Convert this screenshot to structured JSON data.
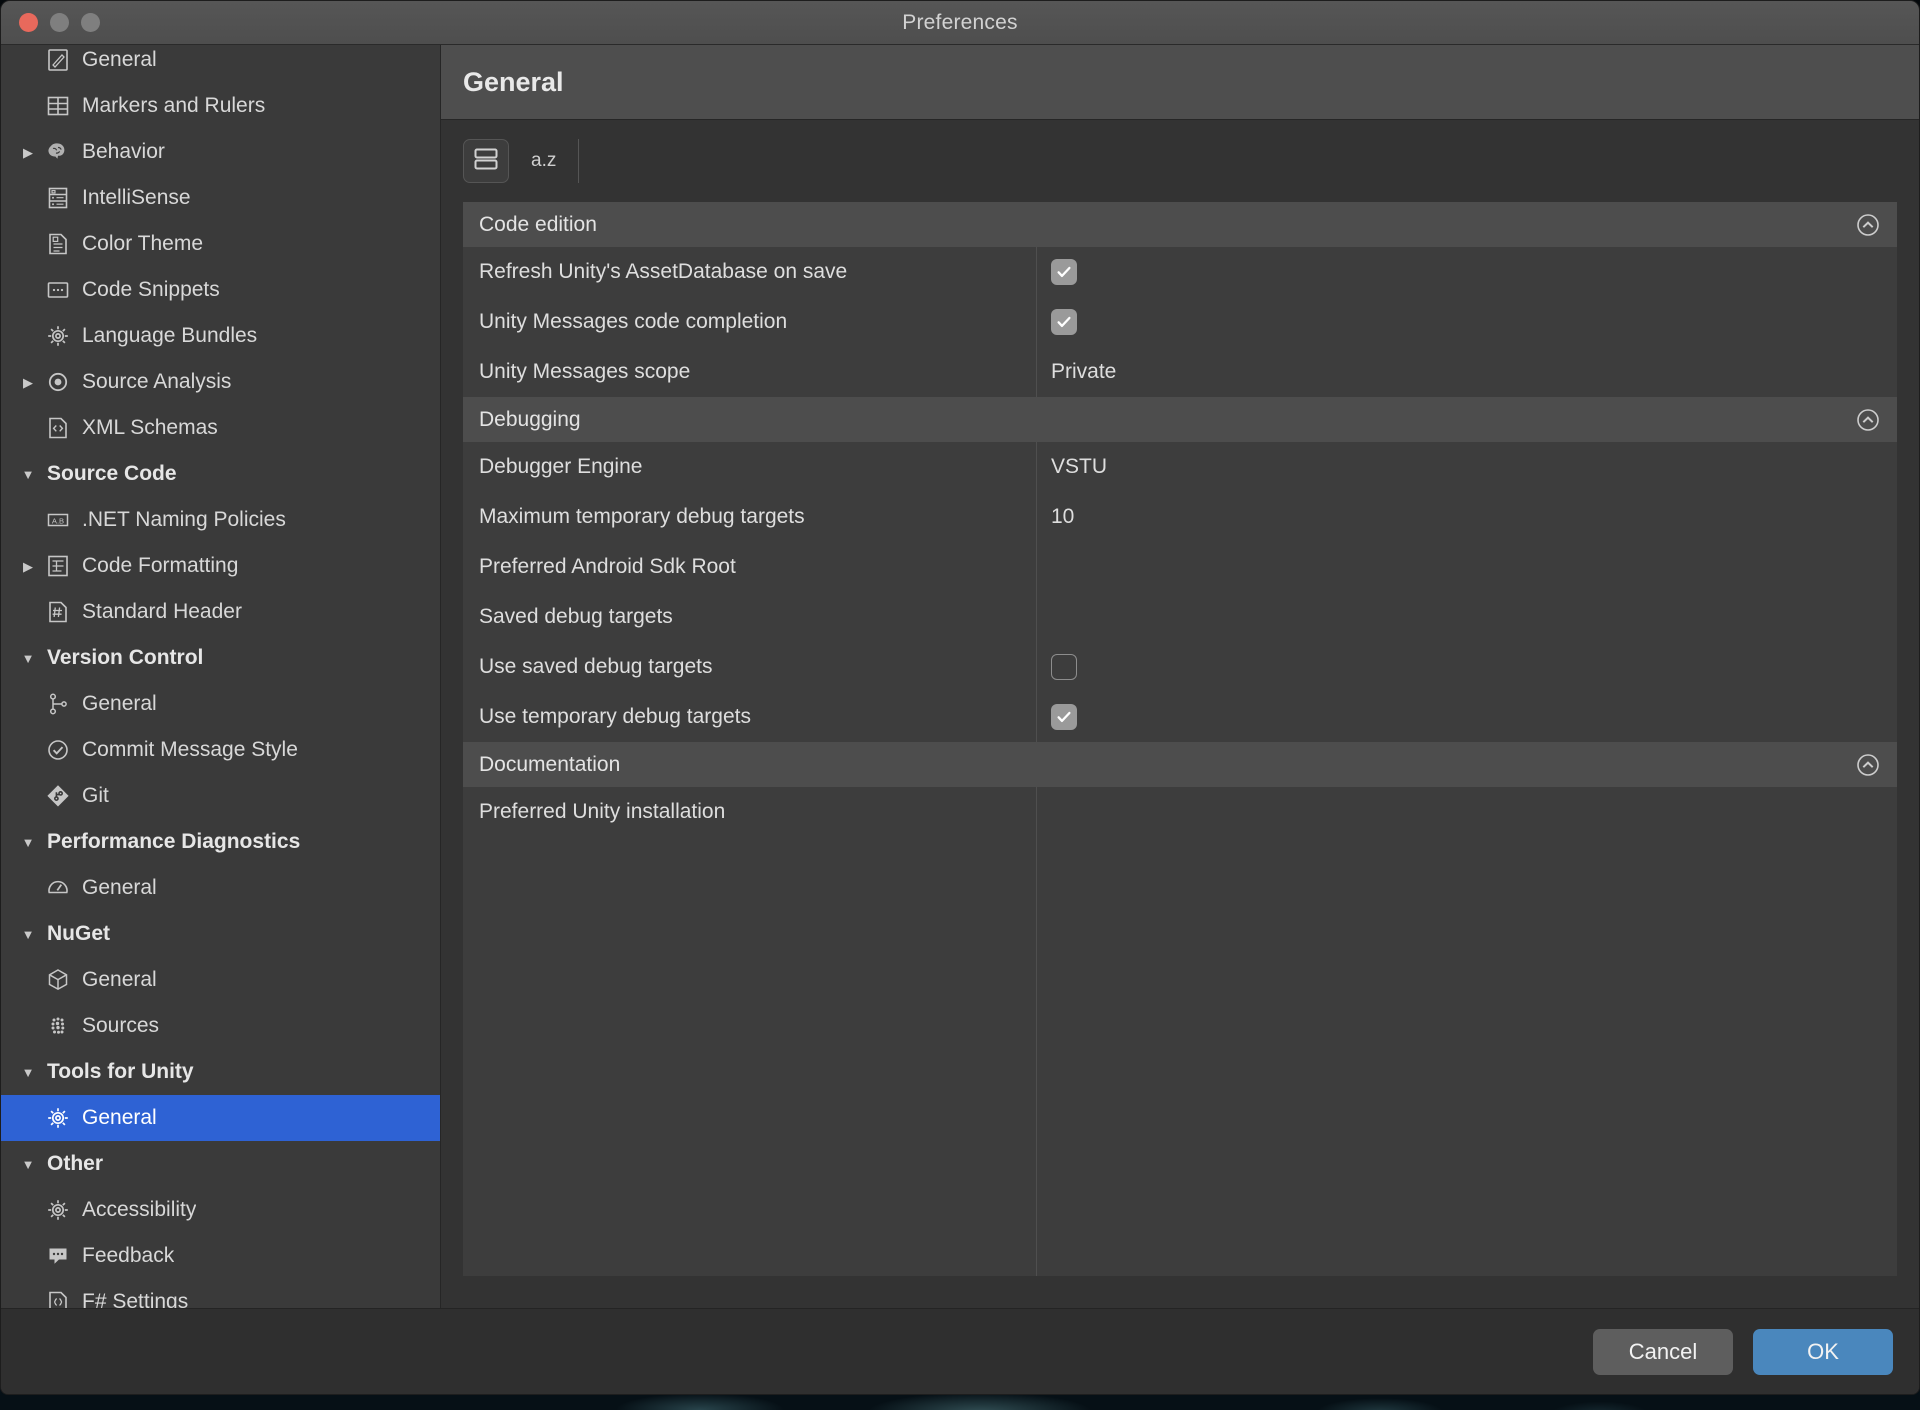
{
  "window": {
    "title": "Preferences",
    "traffic_lights": [
      "close",
      "minimize",
      "zoom"
    ]
  },
  "sidebar": {
    "items": [
      {
        "label": "General",
        "icon": "pencil-document-icon",
        "type": "item",
        "twisty": "none",
        "selected": false,
        "clipped": true
      },
      {
        "label": "Markers and Rulers",
        "icon": "table-grid-icon",
        "type": "item",
        "twisty": "none",
        "selected": false
      },
      {
        "label": "Behavior",
        "icon": "brain-icon",
        "type": "item",
        "twisty": "collapsed",
        "selected": false
      },
      {
        "label": "IntelliSense",
        "icon": "list-server-icon",
        "type": "item",
        "twisty": "none",
        "selected": false
      },
      {
        "label": "Color Theme",
        "icon": "color-document-icon",
        "type": "item",
        "twisty": "none",
        "selected": false
      },
      {
        "label": "Code Snippets",
        "icon": "snippet-icon",
        "type": "item",
        "twisty": "none",
        "selected": false
      },
      {
        "label": "Language Bundles",
        "icon": "gear-icon",
        "type": "item",
        "twisty": "none",
        "selected": false
      },
      {
        "label": "Source Analysis",
        "icon": "radio-target-icon",
        "type": "item",
        "twisty": "collapsed",
        "selected": false
      },
      {
        "label": "XML Schemas",
        "icon": "code-document-icon",
        "type": "item",
        "twisty": "none",
        "selected": false
      },
      {
        "label": "Source Code",
        "icon": "",
        "type": "group",
        "twisty": "expanded",
        "selected": false
      },
      {
        "label": ".NET Naming Policies",
        "icon": "ab-label-icon",
        "type": "item",
        "twisty": "none",
        "selected": false
      },
      {
        "label": "Code Formatting",
        "icon": "tree-format-icon",
        "type": "item",
        "twisty": "collapsed",
        "selected": false
      },
      {
        "label": "Standard Header",
        "icon": "hash-document-icon",
        "type": "item",
        "twisty": "none",
        "selected": false
      },
      {
        "label": "Version Control",
        "icon": "",
        "type": "group",
        "twisty": "expanded",
        "selected": false
      },
      {
        "label": "General",
        "icon": "branch-icon",
        "type": "item",
        "twisty": "none",
        "selected": false
      },
      {
        "label": "Commit Message Style",
        "icon": "check-circle-icon",
        "type": "item",
        "twisty": "none",
        "selected": false
      },
      {
        "label": "Git",
        "icon": "git-icon",
        "type": "item",
        "twisty": "none",
        "selected": false
      },
      {
        "label": "Performance Diagnostics",
        "icon": "",
        "type": "group",
        "twisty": "expanded",
        "selected": false
      },
      {
        "label": "General",
        "icon": "gauge-icon",
        "type": "item",
        "twisty": "none",
        "selected": false
      },
      {
        "label": "NuGet",
        "icon": "",
        "type": "group",
        "twisty": "expanded",
        "selected": false
      },
      {
        "label": "General",
        "icon": "cube-icon",
        "type": "item",
        "twisty": "none",
        "selected": false
      },
      {
        "label": "Sources",
        "icon": "nuget-sources-icon",
        "type": "item",
        "twisty": "none",
        "selected": false
      },
      {
        "label": "Tools for Unity",
        "icon": "",
        "type": "group",
        "twisty": "expanded",
        "selected": false
      },
      {
        "label": "General",
        "icon": "gear-icon",
        "type": "item",
        "twisty": "none",
        "selected": true
      },
      {
        "label": "Other",
        "icon": "",
        "type": "group",
        "twisty": "expanded",
        "selected": false
      },
      {
        "label": "Accessibility",
        "icon": "gear-icon",
        "type": "item",
        "twisty": "none",
        "selected": false
      },
      {
        "label": "Feedback",
        "icon": "speech-bubble-icon",
        "type": "item",
        "twisty": "none",
        "selected": false
      },
      {
        "label": "F# Settings",
        "icon": "braces-document-icon",
        "type": "item",
        "twisty": "none",
        "selected": false
      }
    ]
  },
  "content": {
    "title": "General",
    "toolbar": {
      "group_view_icon": "grouped-rows-icon",
      "sort_label": "a.z"
    },
    "groups": [
      {
        "title": "Code edition",
        "collapse_icon": "chevron-up-circle-icon",
        "rows": [
          {
            "name": "Refresh Unity's AssetDatabase on save",
            "type": "checkbox",
            "checked": true,
            "value": ""
          },
          {
            "name": "Unity Messages code completion",
            "type": "checkbox",
            "checked": true,
            "value": ""
          },
          {
            "name": "Unity Messages scope",
            "type": "text",
            "checked": false,
            "value": "Private"
          }
        ]
      },
      {
        "title": "Debugging",
        "collapse_icon": "chevron-up-circle-icon",
        "rows": [
          {
            "name": "Debugger Engine",
            "type": "text",
            "checked": false,
            "value": "VSTU"
          },
          {
            "name": "Maximum temporary debug targets",
            "type": "text",
            "checked": false,
            "value": "10"
          },
          {
            "name": "Preferred Android Sdk Root",
            "type": "text",
            "checked": false,
            "value": ""
          },
          {
            "name": "Saved debug targets",
            "type": "text",
            "checked": false,
            "value": ""
          },
          {
            "name": "Use saved debug targets",
            "type": "checkbox",
            "checked": false,
            "value": ""
          },
          {
            "name": "Use temporary debug targets",
            "type": "checkbox",
            "checked": true,
            "value": ""
          }
        ]
      },
      {
        "title": "Documentation",
        "collapse_icon": "chevron-up-circle-icon",
        "rows": [
          {
            "name": "Preferred Unity installation",
            "type": "text",
            "checked": false,
            "value": ""
          }
        ]
      }
    ]
  },
  "footer": {
    "cancel_label": "Cancel",
    "ok_label": "OK"
  },
  "colors": {
    "accent_selection": "#2e62d4",
    "accent_ok_button": "#4a87bd",
    "window_bg": "#303030",
    "sidebar_bg": "#3a3a3a",
    "row_bg": "#3d3d3d",
    "group_header_bg": "#4d4d4d",
    "titlebar_bg": "#4e4e4e",
    "close_light": "#e8695c"
  }
}
